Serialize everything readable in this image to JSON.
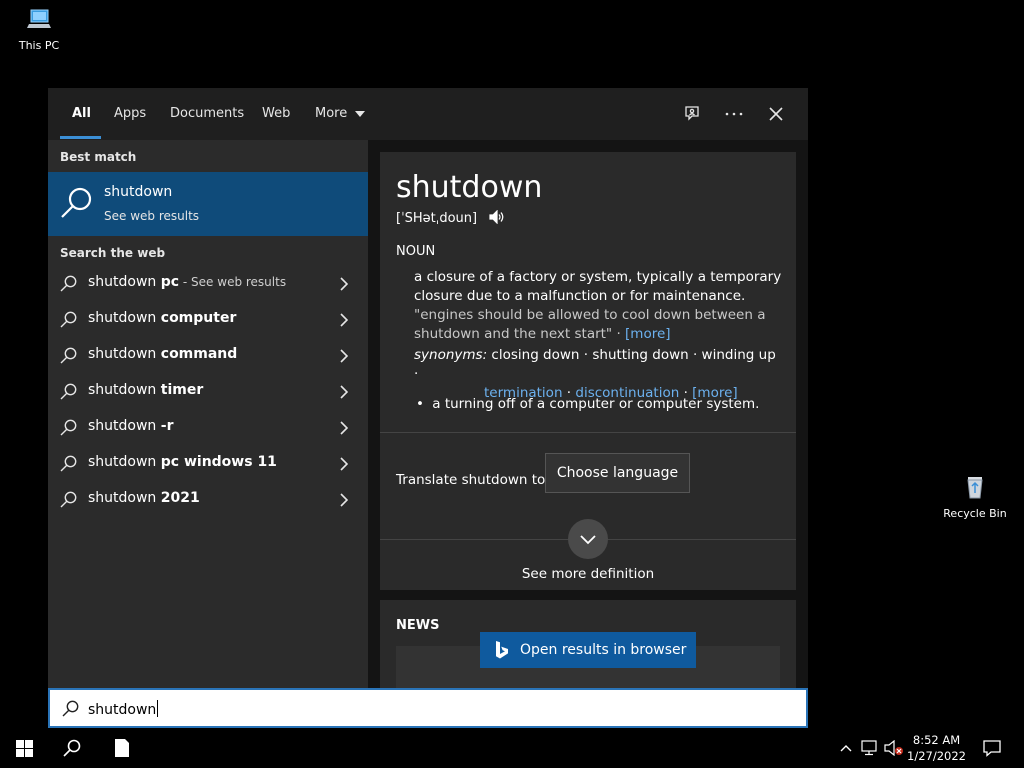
{
  "desktop": {
    "icons": [
      {
        "label": "This PC",
        "icon": "computer-icon"
      },
      {
        "label": "Recycle Bin",
        "icon": "recycle-bin-icon"
      }
    ]
  },
  "search": {
    "tabs": [
      {
        "label": "All",
        "active": true
      },
      {
        "label": "Apps"
      },
      {
        "label": "Documents"
      },
      {
        "label": "Web"
      },
      {
        "label": "More"
      }
    ],
    "toolbar_icons": [
      "feedback-icon",
      "more-options-icon",
      "close-icon"
    ],
    "best_match": {
      "heading": "Best match",
      "title": "shutdown",
      "subtitle": "See web results",
      "icon": "search-icon"
    },
    "web": {
      "heading": "Search the web",
      "suggestions": [
        {
          "prefix": "shutdown ",
          "bold": "pc",
          "suffix": " - See web results"
        },
        {
          "prefix": "shutdown ",
          "bold": "computer",
          "suffix": ""
        },
        {
          "prefix": "shutdown ",
          "bold": "command",
          "suffix": ""
        },
        {
          "prefix": "shutdown ",
          "bold": "timer",
          "suffix": ""
        },
        {
          "prefix": "shutdown ",
          "bold": "-r",
          "suffix": ""
        },
        {
          "prefix": "shutdown ",
          "bold": "pc windows 11",
          "suffix": ""
        },
        {
          "prefix": "shutdown ",
          "bold": "2021",
          "suffix": ""
        }
      ]
    },
    "definition": {
      "word": "shutdown",
      "pronunciation": "[ˈSHətˌdoun]",
      "part_of_speech": "NOUN",
      "sense1": "a closure of a factory or system, typically a temporary closure due to a malfunction or for maintenance.",
      "example": "\"engines should be allowed to cool down between a shutdown and the next start\"",
      "example_sep": " · ",
      "more": "[more]",
      "synonyms_label": "synonyms:",
      "synonyms_plain": "closing down · shutting down · winding up ·",
      "synonym_link1": "termination",
      "synonym_link2": "discontinuation",
      "dot_sep": " · ",
      "more2": "[more]",
      "bullet": "•",
      "sense2": "a turning off of a computer or computer system.",
      "translate_label": "Translate shutdown to",
      "choose_language": "Choose language",
      "see_more": "See more definition"
    },
    "news_heading": "NEWS",
    "open_browser": "Open results in browser",
    "query": "shutdown"
  },
  "taskbar": {
    "time": "8:52 AM",
    "date": "1/27/2022",
    "items": [
      "start-icon",
      "search-icon",
      "file-icon"
    ],
    "tray": [
      "chevron-up-icon",
      "network-icon",
      "volume-muted-icon",
      "notification-icon"
    ]
  },
  "colors": {
    "accent": "#0f4b7a",
    "link": "#6cb1ef",
    "browser_button": "#0f5a9e"
  }
}
